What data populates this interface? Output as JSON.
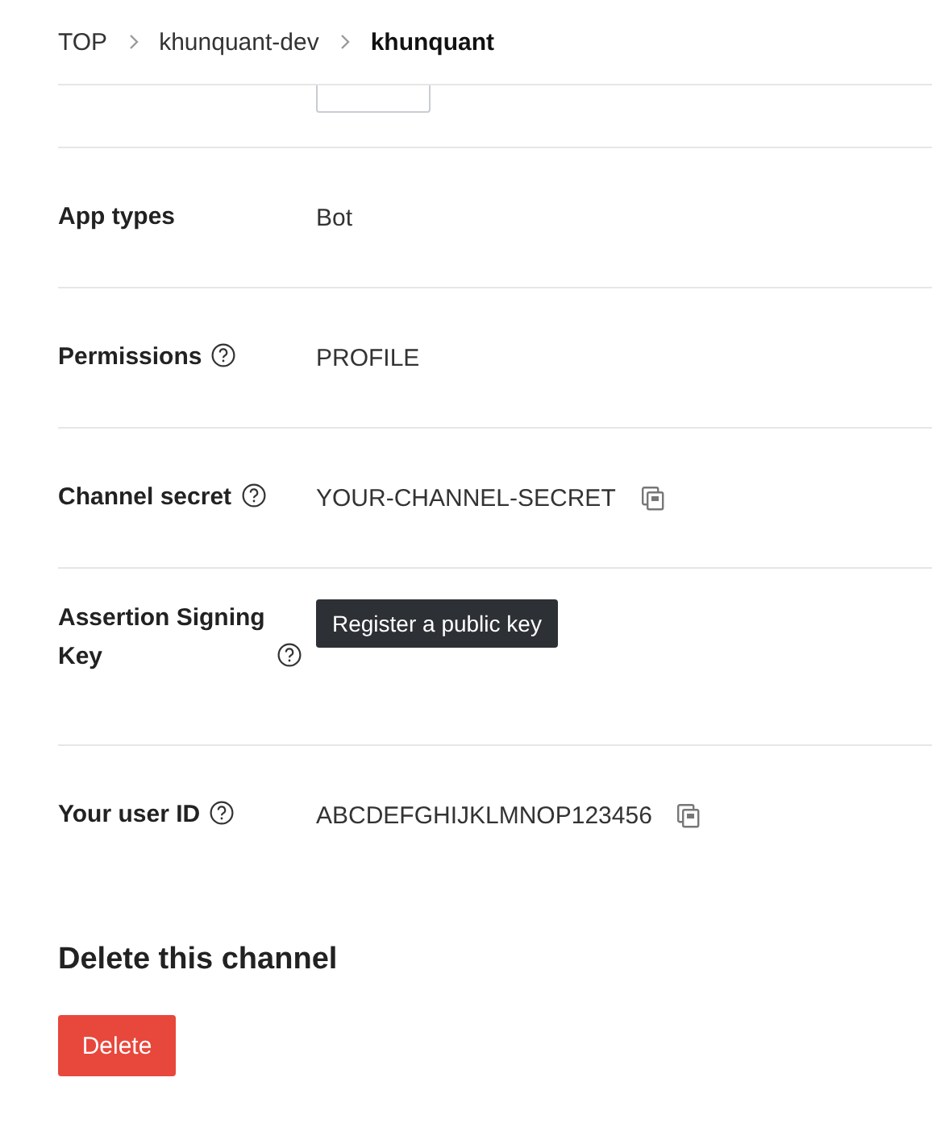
{
  "breadcrumb": [
    {
      "label": "TOP",
      "current": false
    },
    {
      "label": "khunquant-dev",
      "current": false
    },
    {
      "label": "khunquant",
      "current": true
    }
  ],
  "rows": [
    {
      "kind": "text",
      "label": "App types",
      "help": false,
      "value": "Bot",
      "copyable": false
    },
    {
      "kind": "text",
      "label": "Permissions",
      "help": true,
      "value": "PROFILE",
      "copyable": false
    },
    {
      "kind": "text",
      "label": "Channel secret",
      "help": true,
      "value": "YOUR-CHANNEL-SECRET",
      "copyable": true
    },
    {
      "kind": "action",
      "label": "Assertion Signing Key",
      "help": true,
      "button": "Register a public key"
    },
    {
      "kind": "text",
      "label": "Your user ID",
      "help": true,
      "value": "ABCDEFGHIJKLMNOP123456",
      "copyable": true
    }
  ],
  "delete_section": {
    "title": "Delete this channel",
    "button": "Delete"
  }
}
